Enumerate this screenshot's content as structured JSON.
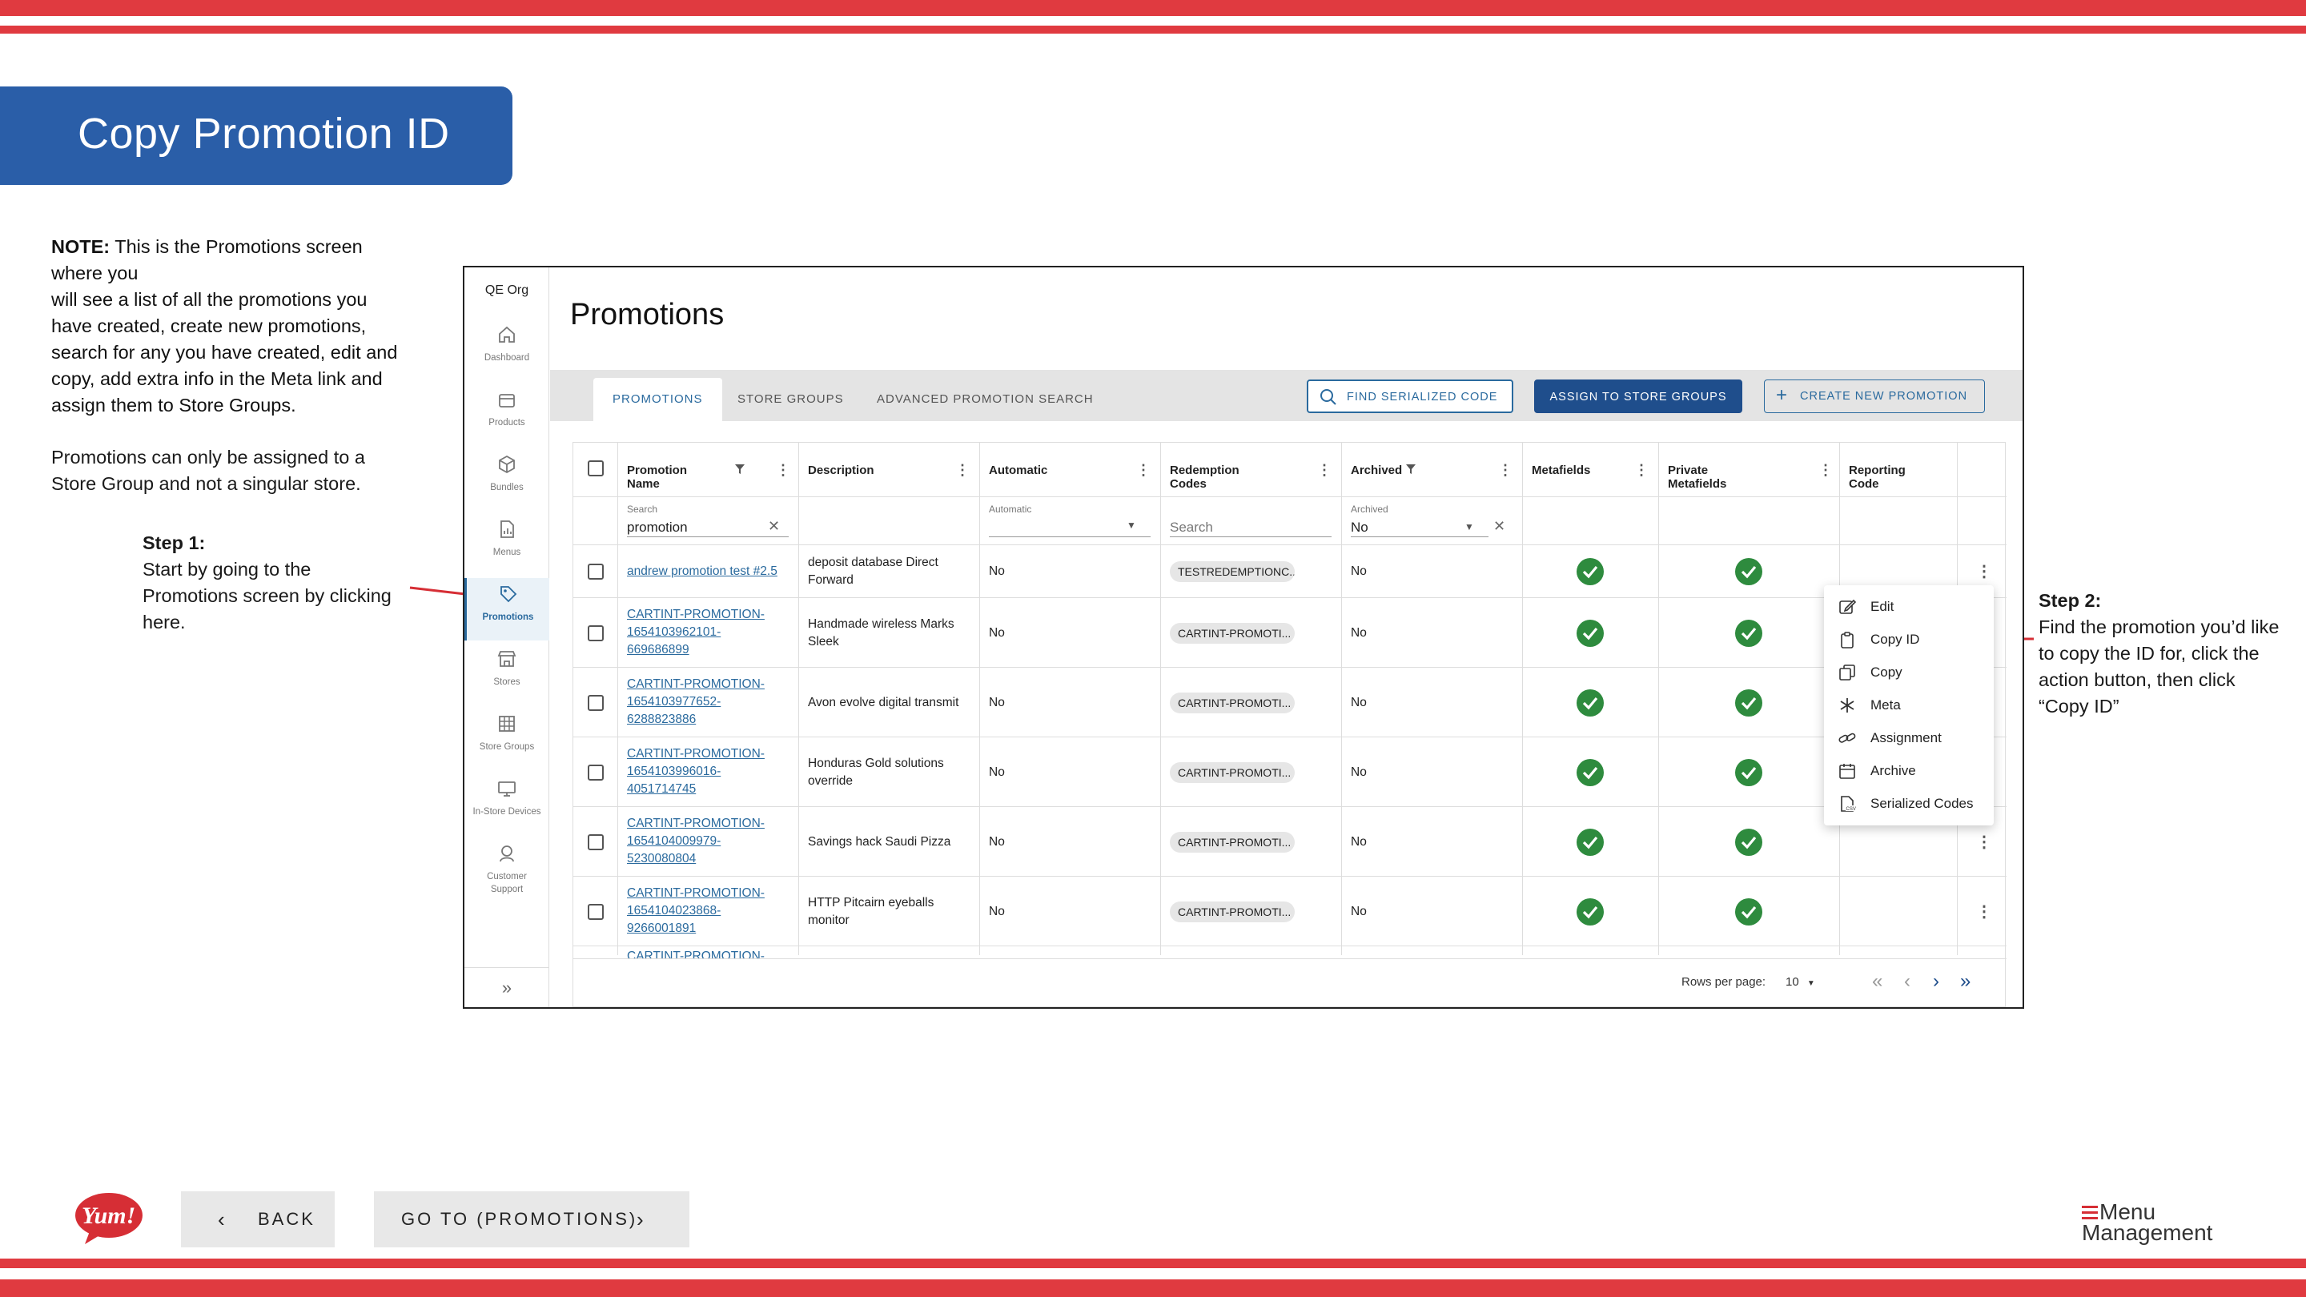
{
  "slide": {
    "title": "Copy Promotion ID",
    "note_label": "NOTE:",
    "note_text": "This is the Promotions screen where you will see a list of all the promotions you have created, create new promotions, search for any you have created, edit and copy, add extra info in the Meta link and assign them to Store Groups.",
    "note_line1": " This is the Promotions screen",
    "note_line2": "where you",
    "note_line3": "will see a list of all the promotions you",
    "note_line4": "have created, create new promotions,",
    "note_line5": "search for any you have created, edit and",
    "note_line6": "copy, add extra info in the Meta link and",
    "note_line7": "assign them to Store Groups.",
    "para2_line1": "Promotions can only be assigned to a",
    "para2_line2": "Store Group and not a singular store.",
    "step1_title": "Step 1:",
    "step1_line1": "Start by going to the",
    "step1_line2": "Promotions screen by clicking",
    "step1_line3": "here.",
    "step2_title": "Step 2:",
    "step2_line1": "Find the promotion you’d like",
    "step2_line2": "to copy the ID for, click the",
    "step2_line3": "action button, then click",
    "step2_line4": "“Copy ID”",
    "back_label": "BACK",
    "goto_label": "GO TO (PROMOTIONS)",
    "logo_left": "Yum!",
    "logo_right_line1": "Menu",
    "logo_right_line2": "Management"
  },
  "colors": {
    "accent_red": "#e03a40",
    "title_blue": "#2a5ea8",
    "link_blue": "#2a6a9e",
    "check_green": "#2e8b3e"
  },
  "app": {
    "org": "QE Org",
    "nav": [
      {
        "label": "Dashboard",
        "icon": "home-icon"
      },
      {
        "label": "Products",
        "icon": "box-icon"
      },
      {
        "label": "Bundles",
        "icon": "cube-icon"
      },
      {
        "label": "Menus",
        "icon": "document-chart-icon"
      },
      {
        "label": "Promotions",
        "icon": "tag-icon"
      },
      {
        "label": "Stores",
        "icon": "store-icon"
      },
      {
        "label": "Store Groups",
        "icon": "grid-icon"
      },
      {
        "label": "In-Store Devices",
        "icon": "monitor-icon"
      },
      {
        "label": "Customer",
        "label2": "Support",
        "icon": "support-icon"
      }
    ],
    "page_title": "Promotions",
    "tabs": [
      "PROMOTIONS",
      "STORE GROUPS",
      "ADVANCED PROMOTION SEARCH"
    ],
    "buttons": {
      "find": "FIND SERIALIZED CODE",
      "assign": "ASSIGN TO STORE GROUPS",
      "create": "CREATE NEW PROMOTION"
    },
    "columns": [
      "Promotion Name",
      "Description",
      "Automatic",
      "Redemption Codes",
      "Archived",
      "Metafields",
      "Private Metafields",
      "Reporting Code"
    ],
    "filters": {
      "name_label": "Search",
      "name_value": "promotion",
      "auto_label": "Automatic",
      "codes_placeholder": "Search",
      "archived_label": "Archived",
      "archived_value": "No"
    },
    "rows": [
      {
        "name": "andrew promotion test #2.5",
        "desc1": "deposit database Direct",
        "desc2": "Forward",
        "auto": "No",
        "code": "TESTREDEMPTIONC...",
        "archived": "No"
      },
      {
        "name1": "CARTINT-PROMOTION-",
        "name2": "1654103962101-",
        "name3": "669686899",
        "desc1": "Handmade wireless Marks",
        "desc2": "Sleek",
        "auto": "No",
        "code": "CARTINT-PROMOTI...",
        "archived": "No"
      },
      {
        "name1": "CARTINT-PROMOTION-",
        "name2": "1654103977652-",
        "name3": "6288823886",
        "desc1": "Avon evolve digital transmit",
        "auto": "No",
        "code": "CARTINT-PROMOTI...",
        "archived": "No"
      },
      {
        "name1": "CARTINT-PROMOTION-",
        "name2": "1654103996016-",
        "name3": "4051714745",
        "desc1": "Honduras Gold solutions",
        "desc2": "override",
        "auto": "No",
        "code": "CARTINT-PROMOTI...",
        "archived": "No"
      },
      {
        "name1": "CARTINT-PROMOTION-",
        "name2": "1654104009979-",
        "name3": "5230080804",
        "desc1": "Savings hack Saudi Pizza",
        "auto": "No",
        "code": "CARTINT-PROMOTI...",
        "archived": "No"
      },
      {
        "name1": "CARTINT-PROMOTION-",
        "name2": "1654104023868-",
        "name3": "9266001891",
        "desc1": "HTTP Pitcairn eyeballs",
        "desc2": "monitor",
        "auto": "No",
        "code": "CARTINT-PROMOTI...",
        "archived": "No"
      }
    ],
    "partial_row": "CARTINT-PROMOTION-",
    "footer": {
      "rows_per_page_label": "Rows per page:",
      "rows_per_page_value": "10"
    },
    "action_menu": [
      {
        "label": "Edit",
        "icon": "edit-icon"
      },
      {
        "label": "Copy ID",
        "icon": "clipboard-icon"
      },
      {
        "label": "Copy",
        "icon": "copy-icon"
      },
      {
        "label": "Meta",
        "icon": "asterisk-icon"
      },
      {
        "label": "Assignment",
        "icon": "link-icon"
      },
      {
        "label": "Archive",
        "icon": "archive-icon"
      },
      {
        "label": "Serialized Codes",
        "icon": "csv-file-icon"
      }
    ]
  }
}
